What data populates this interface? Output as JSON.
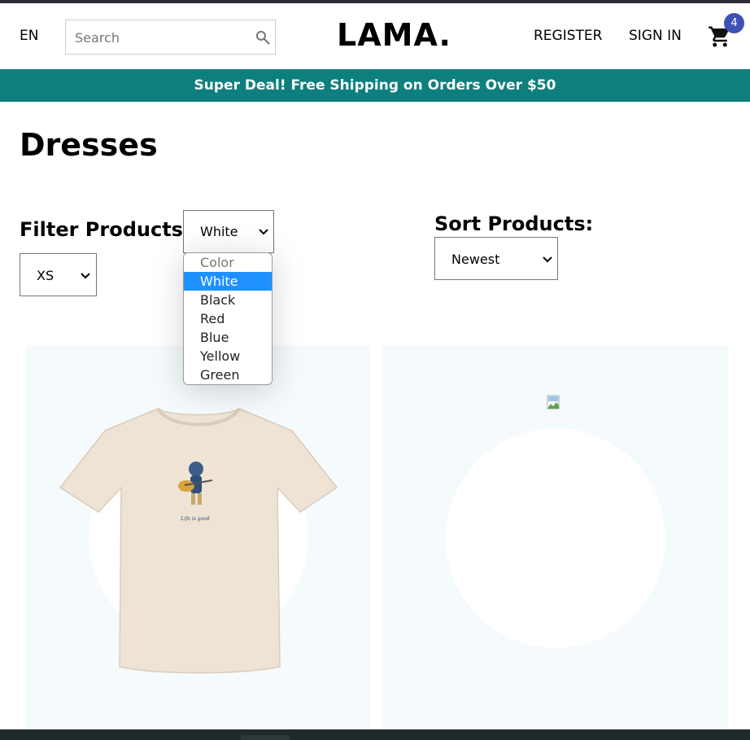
{
  "header": {
    "language": "EN",
    "search_placeholder": "Search",
    "logo": "LAMA.",
    "register_label": "REGISTER",
    "signin_label": "SIGN IN",
    "cart_count": "4"
  },
  "announcement": "Super Deal! Free Shipping on Orders Over $50",
  "page_title": "Dresses",
  "filters": {
    "label": "Filter Products:",
    "color_selected": "White",
    "color_options": [
      "Color",
      "White",
      "Black",
      "Red",
      "Blue",
      "Yellow",
      "Green"
    ],
    "size_selected": "XS"
  },
  "sort": {
    "label": "Sort Products:",
    "selected": "Newest"
  },
  "products": [
    {
      "image": "t-shirt"
    },
    {
      "image": "broken-image"
    }
  ],
  "colors": {
    "announcement_bg": "#0d7f7f",
    "badge_bg": "#3f51b5",
    "product_bg": "#f5fafd",
    "dropdown_selected_bg": "#1e90ff"
  }
}
